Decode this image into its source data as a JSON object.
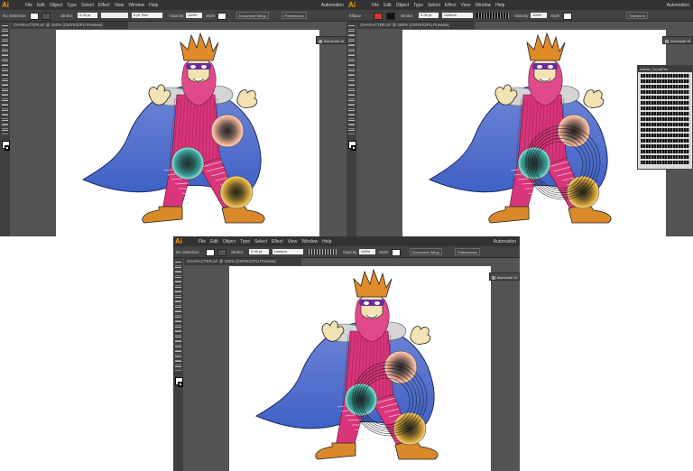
{
  "windows": [
    {
      "logo": "Ai",
      "menu": [
        "File",
        "Edit",
        "Object",
        "Type",
        "Select",
        "Effect",
        "View",
        "Window",
        "Help"
      ],
      "workspace": "Automation",
      "control": {
        "selection": "No Selection",
        "stroke_label": "Stroke:",
        "stroke_value": "0.25 pt",
        "profile": "5 pt. Flat",
        "opacity_label": "Opacity:",
        "opacity_value": "100%",
        "style_label": "Style:",
        "doc_setup": "Document Setup",
        "preferences": "Preferences"
      },
      "doc_tab": "CHARACTER.ai* @ 150% (CMYK/GPU Preview)",
      "panel_button": "Illuminate St"
    },
    {
      "logo": "Ai",
      "menu": [
        "File",
        "Edit",
        "Object",
        "Type",
        "Select",
        "Effect",
        "View",
        "Window",
        "Help"
      ],
      "workspace": "Automation",
      "control": {
        "selection": "Ellipse",
        "stroke_label": "Stroke:",
        "stroke_value": "0.25 pt",
        "profile": "Uniform",
        "opacity_label": "Opacity:",
        "opacity_value": "100%",
        "style_label": "Style:",
        "transform": "Transform"
      },
      "doc_tab": "CHARACTER.ai* @ 150% (CMYK/GPU Preview)",
      "panel_button": "Illuminate St",
      "brush_panel_title": "Artistic_ScrollPen"
    },
    {
      "logo": "Ai",
      "menu": [
        "File",
        "Edit",
        "Object",
        "Type",
        "Select",
        "Effect",
        "View",
        "Window",
        "Help"
      ],
      "workspace": "Automation",
      "control": {
        "selection": "No Selection",
        "stroke_label": "Stroke:",
        "stroke_value": "0.25 pt",
        "profile": "Uniform",
        "opacity_label": "Opacity:",
        "opacity_value": "100%",
        "style_label": "Style:",
        "doc_setup": "Document Setup",
        "preferences": "Preferences"
      },
      "doc_tab": "CHARACTER.ai* @ 150% (CMYK/GPU Preview)",
      "panel_button": "Illuminate St"
    }
  ],
  "colors": {
    "app_bg": "#535353",
    "menubar": "#323232",
    "cape": "#3d5fc4",
    "body_pink": "#d8357a",
    "beard": "#e04a8a",
    "crown": "#e08a2a",
    "boot": "#d9892a",
    "orb_teal": "#3aa7a0",
    "orb_peach": "#e3a48a",
    "orb_gold": "#d6a236"
  }
}
